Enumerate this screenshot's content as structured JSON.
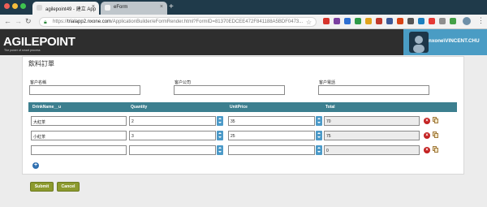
{
  "browser": {
    "tabs": [
      {
        "label": "agilepoint49 - 建立 App"
      },
      {
        "label": "eForm"
      }
    ],
    "url_scheme": "https://",
    "url_host": "trialapp2.nxone.com",
    "url_path": "/ApplicationBuilder/eFormRender.html?FormID=81370EDCEE472F841188A5BDF0473..."
  },
  "header": {
    "logo_text": "AGILEPOINT",
    "logo_tagline": "The power of smart process",
    "username": "nxone\\VINCENT.CHU"
  },
  "form": {
    "title": "飲料訂單",
    "fields": {
      "customer_name": {
        "label": "客户名稱",
        "value": ""
      },
      "customer_company": {
        "label": "客户公司",
        "value": ""
      },
      "customer_phone": {
        "label": "客户電話",
        "value": ""
      }
    },
    "table": {
      "columns": [
        "DrinkName__u",
        "Quantity",
        "UnitPrice",
        "Total"
      ],
      "rows": [
        {
          "drink": "大紅茶",
          "quantity": "2",
          "unit_price": "35",
          "total": "70"
        },
        {
          "drink": "小紅茶",
          "quantity": "3",
          "unit_price": "25",
          "total": "75"
        },
        {
          "drink": "",
          "quantity": "",
          "unit_price": "",
          "total": "0"
        }
      ]
    },
    "buttons": {
      "submit": "Submit",
      "cancel": "Cancel"
    }
  },
  "colors": {
    "table_header": "#3c7f8f",
    "user_panel": "#4a9cc4",
    "button": "#8c9a2e",
    "logo_accent": "#f29a20"
  }
}
